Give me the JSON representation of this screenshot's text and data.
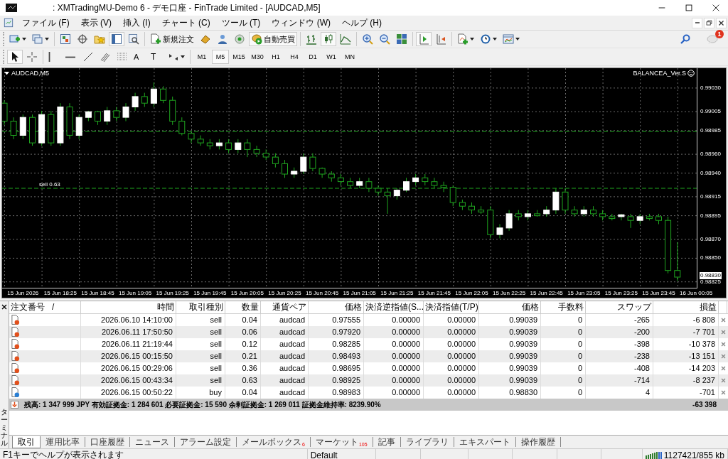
{
  "window": {
    "title": ": XMTradingMU-Demo 6 - デモ口座 - FinTrade Limited - [AUDCAD,M5]"
  },
  "menu": [
    "ファイル (F)",
    "表示 (V)",
    "挿入 (I)",
    "チャート (C)",
    "ツール (T)",
    "ウィンドウ (W)",
    "ヘルプ (H)"
  ],
  "toolbar_1": {
    "groups": [
      [
        {
          "selected": false
        },
        {
          "selected": false
        }
      ],
      [
        {
          "selected": false
        },
        {
          "selected": false
        },
        {
          "selected": false
        },
        {
          "selected": true
        },
        {
          "selected": false
        }
      ],
      [
        {
          "label": "新規注文",
          "selected": false
        },
        {
          "selected": false
        },
        {
          "selected": false
        },
        {
          "selected": false
        },
        {
          "label": "自動売買",
          "selected": true
        }
      ],
      [
        {
          "selected": false
        },
        {
          "selected": true
        },
        {
          "selected": false
        }
      ],
      [
        {
          "selected": false
        },
        {
          "selected": false
        },
        {
          "selected": false
        }
      ],
      [
        {
          "selected": true
        },
        {
          "selected": false
        }
      ],
      [
        {
          "selected": false
        },
        {
          "selected": false
        },
        {
          "selected": false
        }
      ]
    ],
    "notification_badge": "1"
  },
  "toolbar_2": {
    "groups": [
      [
        {
          "selected": true
        },
        {
          "selected": false
        }
      ],
      [
        {
          "selected": false
        },
        {
          "selected": false
        },
        {
          "selected": false
        },
        {
          "selected": false
        },
        {
          "selected": false
        },
        {
          "label": "A",
          "selected": false
        },
        {
          "label": "T",
          "selected": false
        },
        {
          "selected": false
        }
      ]
    ],
    "timeframes": [
      {
        "label": "M1",
        "selected": false
      },
      {
        "label": "M5",
        "selected": true
      },
      {
        "label": "M15",
        "selected": false
      },
      {
        "label": "M30",
        "selected": false
      },
      {
        "label": "H1",
        "selected": false
      },
      {
        "label": "H4",
        "selected": false
      },
      {
        "label": "D1",
        "selected": false
      },
      {
        "label": "W1",
        "selected": false
      },
      {
        "label": "MN",
        "selected": false
      }
    ]
  },
  "chart": {
    "symbol": "AUDCAD,M5",
    "expert": "BALANCEA_Ver.S",
    "current_price": "0.98830",
    "chart_data": {
      "type": "candlestick",
      "grid": true,
      "ylim": [
        0.98818,
        0.99051
      ],
      "ref_lines": [
        {
          "axis": "y",
          "value": 0.98984
        },
        {
          "axis": "y",
          "value": 0.98924,
          "label": "sell 0.63"
        }
      ],
      "categories": [
        null,
        null,
        "15 Jun 2026",
        null,
        null,
        null,
        "15 Jun 18:25",
        null,
        null,
        null,
        "15 Jun 18:45",
        null,
        null,
        null,
        "15 Jun 19:05",
        null,
        null,
        null,
        "15 Jun 19:25",
        null,
        null,
        null,
        "15 Jun 19:45",
        null,
        null,
        null,
        "15 Jun 20:05",
        null,
        null,
        null,
        "15 Jun 20:25",
        null,
        null,
        null,
        "15 Jun 20:45",
        null,
        null,
        null,
        "15 Jun 21:05",
        null,
        null,
        null,
        "15 Jun 21:25",
        null,
        null,
        null,
        "15 Jun 21:45",
        null,
        null,
        null,
        "15 Jun 22:05",
        null,
        null,
        null,
        "15 Jun 22:25",
        null,
        null,
        null,
        "15 Jun 22:45",
        null,
        null,
        null,
        "15 Jun 23:05",
        null,
        null,
        null,
        "15 Jun 23:25",
        null,
        null,
        null,
        "15 Jun 23:45",
        null,
        null,
        null,
        "16 Jun 00:05"
      ],
      "yticks": [
        {
          "value": 0.9903,
          "label": "0.99030"
        },
        {
          "value": 0.99005,
          "label": "0.99005"
        },
        {
          "value": 0.98985,
          "label": "0.98985"
        },
        {
          "value": 0.9896,
          "label": "0.98960"
        },
        {
          "value": 0.9894,
          "label": "0.98940"
        },
        {
          "value": 0.98915,
          "label": "0.98915"
        },
        {
          "value": 0.98895,
          "label": "0.98895"
        },
        {
          "value": 0.9887,
          "label": "0.98870"
        },
        {
          "value": 0.9885,
          "label": "0.98850"
        },
        {
          "value": 0.98825,
          "label": "0.98825"
        }
      ],
      "ohlc": [
        [
          0.99014,
          0.99017,
          0.98991,
          0.98995
        ],
        [
          0.98995,
          0.98999,
          0.98976,
          0.9898
        ],
        [
          0.9898,
          0.99002,
          0.98976,
          0.98999
        ],
        [
          0.98999,
          0.99002,
          0.98969,
          0.98972
        ],
        [
          0.98972,
          0.99006,
          0.98969,
          0.99002
        ],
        [
          0.99002,
          0.99006,
          0.98969,
          0.98972
        ],
        [
          0.98972,
          0.99014,
          0.98969,
          0.9901
        ],
        [
          0.9901,
          0.99014,
          0.98976,
          0.9898
        ],
        [
          0.9898,
          0.99002,
          0.98976,
          0.98999
        ],
        [
          0.98999,
          0.99006,
          0.98995,
          0.99005
        ],
        [
          0.99005,
          0.99006,
          0.98991,
          0.98995
        ],
        [
          0.98995,
          0.9901,
          0.98991,
          0.99006
        ],
        [
          0.99006,
          0.9901,
          0.98995,
          0.98999
        ],
        [
          0.98999,
          0.99014,
          0.98995,
          0.9901
        ],
        [
          0.9901,
          0.99025,
          0.99006,
          0.99021
        ],
        [
          0.99021,
          0.99025,
          0.9901,
          0.99014
        ],
        [
          0.99014,
          0.99036,
          0.9901,
          0.99029
        ],
        [
          0.99029,
          0.99032,
          0.99014,
          0.99017
        ],
        [
          0.99017,
          0.99021,
          0.98991,
          0.98995
        ],
        [
          0.98995,
          0.98999,
          0.9898,
          0.98982
        ],
        [
          0.98982,
          0.98984,
          0.98972,
          0.98976
        ],
        [
          0.98976,
          0.9898,
          0.98969,
          0.98972
        ],
        [
          0.98972,
          0.98976,
          0.98965,
          0.98969
        ],
        [
          0.98969,
          0.98976,
          0.98965,
          0.98972
        ],
        [
          0.98972,
          0.98976,
          0.98961,
          0.98965
        ],
        [
          0.98965,
          0.98976,
          0.98961,
          0.98972
        ],
        [
          0.98972,
          0.98976,
          0.98957,
          0.98965
        ],
        [
          0.98965,
          0.98969,
          0.98957,
          0.98961
        ],
        [
          0.98961,
          0.98965,
          0.98954,
          0.98957
        ],
        [
          0.98957,
          0.98961,
          0.98946,
          0.9895
        ],
        [
          0.9895,
          0.98954,
          0.98935,
          0.98939
        ],
        [
          0.98939,
          0.98946,
          0.98935,
          0.98942
        ],
        [
          0.98942,
          0.98961,
          0.98939,
          0.98957
        ],
        [
          0.98957,
          0.98961,
          0.98942,
          0.98945
        ],
        [
          0.98945,
          0.98946,
          0.98935,
          0.98939
        ],
        [
          0.98939,
          0.98942,
          0.98931,
          0.98935
        ],
        [
          0.98935,
          0.98939,
          0.98927,
          0.98931
        ],
        [
          0.98931,
          0.98935,
          0.98924,
          0.98927
        ],
        [
          0.98927,
          0.98935,
          0.98924,
          0.98931
        ],
        [
          0.98931,
          0.98935,
          0.9892,
          0.98924
        ],
        [
          0.98924,
          0.98927,
          0.98916,
          0.9892
        ],
        [
          0.9892,
          0.98924,
          0.98897,
          0.98916
        ],
        [
          0.98916,
          0.98924,
          0.98912,
          0.98922
        ],
        [
          0.98922,
          0.98935,
          0.9892,
          0.98931
        ],
        [
          0.98931,
          0.98939,
          0.98927,
          0.98935
        ],
        [
          0.98935,
          0.98939,
          0.98927,
          0.98931
        ],
        [
          0.98931,
          0.98935,
          0.98924,
          0.98927
        ],
        [
          0.98927,
          0.98931,
          0.9892,
          0.98925
        ],
        [
          0.98925,
          0.98927,
          0.98905,
          0.98909
        ],
        [
          0.98909,
          0.98912,
          0.98901,
          0.98905
        ],
        [
          0.98905,
          0.98909,
          0.98897,
          0.98901
        ],
        [
          0.98901,
          0.98905,
          0.98897,
          0.98899
        ],
        [
          0.98901,
          0.98905,
          0.98871,
          0.98875
        ],
        [
          0.98875,
          0.98886,
          0.98871,
          0.98882
        ],
        [
          0.98882,
          0.98901,
          0.98879,
          0.98897
        ],
        [
          0.98897,
          0.98901,
          0.9889,
          0.98894
        ],
        [
          0.98894,
          0.98901,
          0.9889,
          0.98897
        ],
        [
          0.98897,
          0.98901,
          0.98894,
          0.98895
        ],
        [
          0.98897,
          0.98905,
          0.98894,
          0.98901
        ],
        [
          0.98901,
          0.98924,
          0.98897,
          0.9892
        ],
        [
          0.9892,
          0.98924,
          0.98897,
          0.98901
        ],
        [
          0.98901,
          0.98905,
          0.98894,
          0.98897
        ],
        [
          0.98897,
          0.98905,
          0.98894,
          0.98901
        ],
        [
          0.98901,
          0.98905,
          0.98894,
          0.98897
        ],
        [
          0.98897,
          0.98901,
          0.9889,
          0.98894
        ],
        [
          0.98894,
          0.98897,
          0.9889,
          0.98892
        ],
        [
          0.98894,
          0.98897,
          0.9889,
          0.98896
        ],
        [
          0.98894,
          0.98897,
          0.98882,
          0.9889
        ],
        [
          0.9889,
          0.98897,
          0.98886,
          0.98894
        ],
        [
          0.98894,
          0.98897,
          0.9889,
          0.98892
        ],
        [
          0.98894,
          0.98897,
          0.98886,
          0.9889
        ],
        [
          0.9889,
          0.98894,
          0.98834,
          0.98837
        ],
        [
          0.98837,
          0.98867,
          0.98826,
          0.9883
        ],
        null,
        null
      ]
    }
  },
  "terminal": {
    "side_title": "ターミナル",
    "columns": [
      "注文番号",
      "時間",
      "取引種別",
      "数量",
      "通貨ペア",
      "価格",
      "決済逆指値(S...",
      "決済指値(T/P)",
      "価格",
      "手数料",
      "スワップ",
      "損益"
    ],
    "sort_mark": "/",
    "rows": [
      {
        "kind": "sell",
        "cells": [
          "",
          "2026.06.10 14:10:00",
          "sell",
          "0.04",
          "audcad",
          "0.97555",
          "0.00000",
          "0.00000",
          "0.99039",
          "0",
          "-265",
          "-6 808"
        ]
      },
      {
        "kind": "sell",
        "cells": [
          "",
          "2026.06.11 17:50:50",
          "sell",
          "0.06",
          "audcad",
          "0.97920",
          "0.00000",
          "0.00000",
          "0.99039",
          "0",
          "-200",
          "-7 701"
        ]
      },
      {
        "kind": "sell",
        "cells": [
          "",
          "2026.06.11 21:19:44",
          "sell",
          "0.12",
          "audcad",
          "0.98285",
          "0.00000",
          "0.00000",
          "0.99039",
          "0",
          "-398",
          "-10 378"
        ]
      },
      {
        "kind": "sell",
        "cells": [
          "",
          "2026.06.15 00:15:50",
          "sell",
          "0.21",
          "audcad",
          "0.98493",
          "0.00000",
          "0.00000",
          "0.99039",
          "0",
          "-238",
          "-13 151"
        ]
      },
      {
        "kind": "sell",
        "cells": [
          "",
          "2026.06.15 00:29:06",
          "sell",
          "0.36",
          "audcad",
          "0.98695",
          "0.00000",
          "0.00000",
          "0.99039",
          "0",
          "-408",
          "-14 203"
        ]
      },
      {
        "kind": "sell",
        "cells": [
          "",
          "2026.06.15 00:43:34",
          "sell",
          "0.63",
          "audcad",
          "0.98925",
          "0.00000",
          "0.00000",
          "0.99039",
          "0",
          "-714",
          "-8 237"
        ]
      },
      {
        "kind": "buy",
        "cells": [
          "",
          "2026.06.15 00:50:22",
          "buy",
          "0.04",
          "audcad",
          "0.98983",
          "0.00000",
          "0.00000",
          "0.98830",
          "0",
          "4",
          "-701"
        ]
      }
    ],
    "summary": {
      "text": "残高: 1 347 999 JPY  有効証拠金: 1 284 601  必要証拠金: 15 590  余剰証拠金: 1 269 011  証拠金維持率: 8239.90%",
      "profit": "-63 398"
    },
    "tabs": [
      {
        "label": "取引",
        "selected": true
      },
      {
        "label": "運用比率",
        "selected": false
      },
      {
        "label": "口座履歴",
        "selected": false
      },
      {
        "label": "ニュース",
        "selected": false
      },
      {
        "label": "アラーム設定",
        "selected": false
      },
      {
        "label": "メールボックス",
        "badge": "6",
        "selected": false
      },
      {
        "label": "マーケット",
        "badge": "105",
        "selected": false
      },
      {
        "label": "記事",
        "selected": false
      },
      {
        "label": "ライブラリ",
        "selected": false
      },
      {
        "label": "エキスパート",
        "selected": false
      },
      {
        "label": "操作履歴",
        "selected": false
      }
    ]
  },
  "status_bar": {
    "help": "F1キーでヘルプが表示されます",
    "profile": "Default",
    "traffic": "1127421/855 kb"
  }
}
